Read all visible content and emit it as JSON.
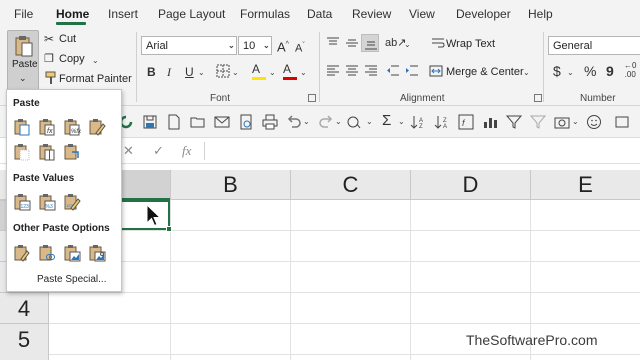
{
  "menu": {
    "tabs": [
      "File",
      "Home",
      "Insert",
      "Page Layout",
      "Formulas",
      "Data",
      "Review",
      "View",
      "Developer",
      "Help"
    ],
    "active_tab": "Home"
  },
  "ribbon": {
    "clipboard": {
      "paste_label": "Paste",
      "cut_label": "Cut",
      "copy_label": "Copy",
      "format_painter_label": "Format Painter"
    },
    "font": {
      "group_label": "Font",
      "font_name": "Arial",
      "font_size": "10",
      "grow_label": "A",
      "shrink_label": "A",
      "bold_label": "B",
      "italic_label": "I",
      "underline_label": "U",
      "fill_label": "A",
      "font_color_label": "A"
    },
    "alignment": {
      "group_label": "Alignment",
      "wrap_text_label": "Wrap Text",
      "merge_center_label": "Merge & Center"
    },
    "number": {
      "group_label": "Number",
      "format": "General",
      "currency_label": "$",
      "percent_label": "%",
      "comma_label": "9"
    }
  },
  "formula_bar": {
    "cancel_label": "✕",
    "enter_label": "✓",
    "function_label": "fx",
    "content": ""
  },
  "grid": {
    "columns": [
      "B",
      "C",
      "D",
      "E"
    ],
    "visible_rows": [
      "4",
      "5"
    ]
  },
  "paste_menu": {
    "paste_heading": "Paste",
    "paste_values_heading": "Paste Values",
    "other_heading": "Other Paste Options",
    "paste_special_label": "Paste Special..."
  },
  "watermark": "TheSoftwarePro.com",
  "colors": {
    "accent": "#217346",
    "ribbon_bg": "#f3f3f3",
    "fill_yellow": "#ffe400",
    "font_red": "#e00000"
  }
}
